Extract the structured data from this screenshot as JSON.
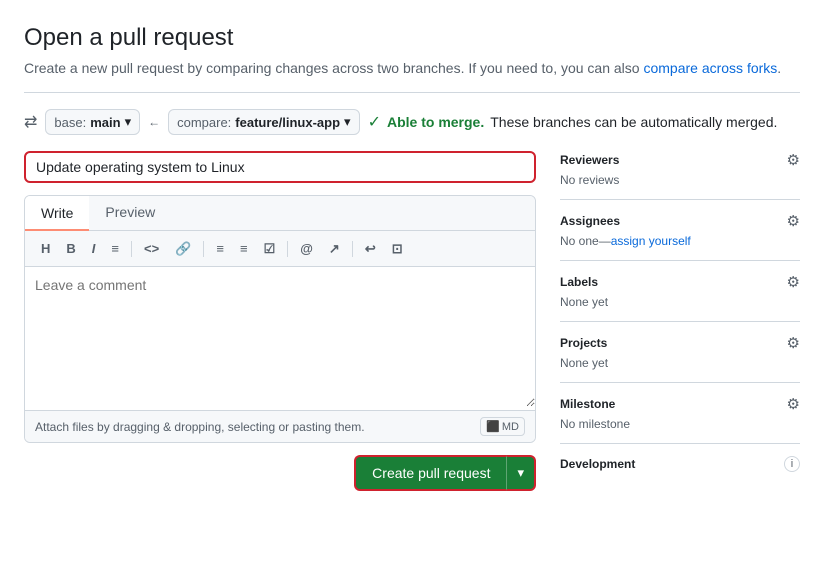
{
  "page": {
    "title": "Open a pull request",
    "subtitle": "Create a new pull request by comparing changes across two branches. If you need to, you can also",
    "subtitle_link_text": "compare across forks",
    "subtitle_link": "#"
  },
  "branch_bar": {
    "base_label": "base:",
    "base_value": "main",
    "arrow": "←",
    "compare_label": "compare:",
    "compare_value": "feature/linux-app",
    "merge_status": "Able to merge.",
    "merge_description": "These branches can be automatically merged."
  },
  "editor": {
    "title_value": "Update operating system to Linux",
    "tab_write": "Write",
    "tab_preview": "Preview",
    "toolbar": {
      "heading": "H",
      "bold": "B",
      "italic": "I",
      "quote": "≡",
      "code": "<>",
      "link": "⬡",
      "bullet_list": "≡",
      "numbered_list": "≡",
      "task_list": "☑",
      "mention": "@",
      "reference": "↗",
      "undo": "↩",
      "preview_toggle": "⊡"
    },
    "comment_placeholder": "Leave a comment",
    "attach_text": "Attach files by dragging & dropping, selecting or pasting them.",
    "md_label": "MD",
    "submit_button": "Create pull request",
    "submit_dropdown_arrow": "▾"
  },
  "sidebar": {
    "reviewers": {
      "title": "Reviewers",
      "value": "No reviews"
    },
    "assignees": {
      "title": "Assignees",
      "value": "No one",
      "link_text": "assign yourself"
    },
    "labels": {
      "title": "Labels",
      "value": "None yet"
    },
    "projects": {
      "title": "Projects",
      "value": "None yet"
    },
    "milestone": {
      "title": "Milestone",
      "value": "No milestone"
    },
    "development": {
      "title": "Development"
    }
  }
}
